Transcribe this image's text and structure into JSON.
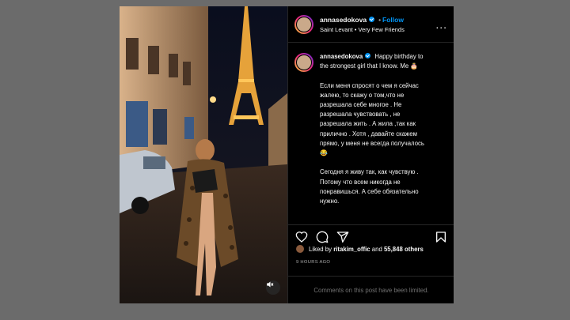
{
  "post": {
    "username": "annasedokova",
    "follow_label": "Follow",
    "dot": "•",
    "location": "Saint Levant • Very Few Friends",
    "more_label": "...",
    "caption_lines": [
      "Happy birthday to",
      "the strongest girl that I know. Me 🎂",
      "",
      "Если меня спросят о чем я сейчас",
      "жалею, то скажу о том,что не",
      "разрешала себе многое . Не",
      "разрешала чувствовать , не",
      "разрешала жить . А жила ,так как",
      "прилично . Хотя , давайте скажем",
      "прямо, у меня не всегда получалось",
      "😂",
      "",
      "Сегодня я живу так, как чувствую .",
      "Потому что всем никогда не",
      "понравишься. А себе обязательно",
      "нужно."
    ],
    "likes_prefix": "Liked by",
    "likes_user": "ritakim_offic",
    "likes_and": "and",
    "likes_count": "55,848 others",
    "time_ago": "9 HOURS AGO",
    "comments_limited": "Comments on this post have been limited."
  },
  "icons": [
    "heart-icon",
    "comment-icon",
    "share-icon",
    "bookmark-icon",
    "mute-icon",
    "verified-badge-icon",
    "more-options-icon"
  ],
  "colors": {
    "accent": "#0095f6",
    "background": "#000000",
    "overlay": "#6b6b6b",
    "muted": "#737373"
  }
}
